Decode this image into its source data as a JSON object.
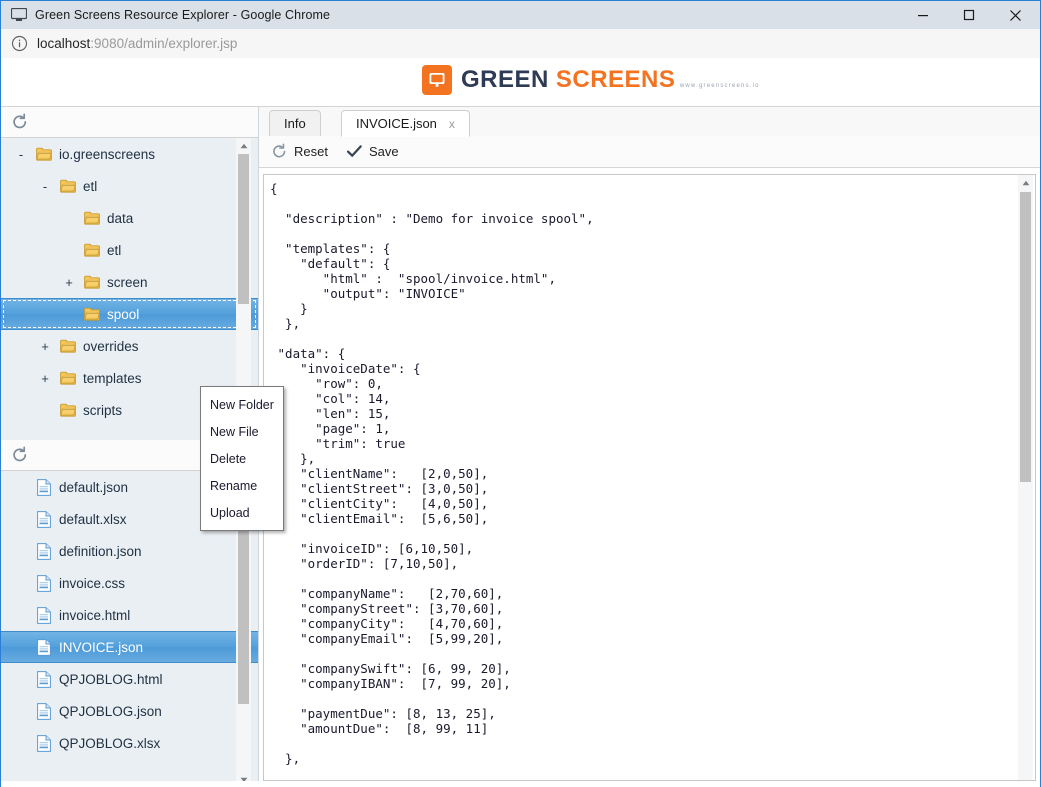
{
  "window": {
    "title": "Green Screens Resource Explorer - Google Chrome",
    "minimize_label": "Minimize",
    "maximize_label": "Maximize",
    "close_label": "Close"
  },
  "address_bar": {
    "host": "localhost",
    "rest": ":9080/admin/explorer.jsp",
    "full_url": "localhost:9080/admin/explorer.jsp",
    "info_icon": "info-circle-icon"
  },
  "brand": {
    "word1": "GREEN",
    "word2": "SCREENS",
    "site": "www.greenscreens.io",
    "mark_icon": "monitor-icon",
    "color_green": "#2e3b55",
    "color_orange": "#f37321"
  },
  "tree_panel": {
    "refresh_icon": "refresh-icon",
    "refresh_label": "Refresh",
    "items": [
      {
        "label": "io.greenscreens",
        "toggle": "-",
        "depth": 0,
        "selected": false,
        "icon": "folder-icon"
      },
      {
        "label": "etl",
        "toggle": "-",
        "depth": 1,
        "selected": false,
        "icon": "folder-icon"
      },
      {
        "label": "data",
        "toggle": "",
        "depth": 2,
        "selected": false,
        "icon": "folder-icon"
      },
      {
        "label": "etl",
        "toggle": "",
        "depth": 2,
        "selected": false,
        "icon": "folder-icon"
      },
      {
        "label": "screen",
        "toggle": "+",
        "depth": 2,
        "selected": false,
        "icon": "folder-icon"
      },
      {
        "label": "spool",
        "toggle": "",
        "depth": 2,
        "selected": true,
        "icon": "folder-icon"
      },
      {
        "label": "overrides",
        "toggle": "+",
        "depth": 1,
        "selected": false,
        "icon": "folder-icon"
      },
      {
        "label": "templates",
        "toggle": "+",
        "depth": 1,
        "selected": false,
        "icon": "folder-icon"
      },
      {
        "label": "scripts",
        "toggle": "",
        "depth": 1,
        "selected": false,
        "icon": "folder-icon"
      }
    ]
  },
  "context_menu": {
    "items": [
      {
        "label": "New Folder"
      },
      {
        "label": "New File"
      },
      {
        "label": "Delete"
      },
      {
        "label": "Rename"
      },
      {
        "label": "Upload"
      }
    ]
  },
  "file_panel": {
    "refresh_icon": "refresh-icon",
    "refresh_label": "Refresh",
    "items": [
      {
        "label": "default.json",
        "selected": false,
        "icon": "file-icon"
      },
      {
        "label": "default.xlsx",
        "selected": false,
        "icon": "file-icon"
      },
      {
        "label": "definition.json",
        "selected": false,
        "icon": "file-icon"
      },
      {
        "label": "invoice.css",
        "selected": false,
        "icon": "file-icon"
      },
      {
        "label": "invoice.html",
        "selected": false,
        "icon": "file-icon"
      },
      {
        "label": "INVOICE.json",
        "selected": true,
        "icon": "file-icon"
      },
      {
        "label": "QPJOBLOG.html",
        "selected": false,
        "icon": "file-icon"
      },
      {
        "label": "QPJOBLOG.json",
        "selected": false,
        "icon": "file-icon"
      },
      {
        "label": "QPJOBLOG.xlsx",
        "selected": false,
        "icon": "file-icon"
      }
    ]
  },
  "tabs": [
    {
      "label": "Info",
      "active": false,
      "closable": false
    },
    {
      "label": "INVOICE.json",
      "active": true,
      "closable": true,
      "close_glyph": "x"
    }
  ],
  "editor_toolbar": {
    "reset_label": "Reset",
    "reset_icon": "refresh-icon",
    "save_label": "Save",
    "save_icon": "check-icon"
  },
  "editor": {
    "filename": "INVOICE.json",
    "content": "{\n\n  \"description\" : \"Demo for invoice spool\",\n\n  \"templates\": {\n    \"default\": {\n       \"html\" :  \"spool/invoice.html\",\n       \"output\": \"INVOICE\"\n    }\n  },\n\n \"data\": {\n    \"invoiceDate\": {\n      \"row\": 0,\n      \"col\": 14,\n      \"len\": 15,\n      \"page\": 1,\n      \"trim\": true\n    },\n    \"clientName\":   [2,0,50],\n    \"clientStreet\": [3,0,50],\n    \"clientCity\":   [4,0,50],\n    \"clientEmail\":  [5,6,50],\n\n    \"invoiceID\": [6,10,50],\n    \"orderID\": [7,10,50],\n\n    \"companyName\":   [2,70,60],\n    \"companyStreet\": [3,70,60],\n    \"companyCity\":   [4,70,60],\n    \"companyEmail\":  [5,99,20],\n\n    \"companySwift\": [6, 99, 20],\n    \"companyIBAN\":  [7, 99, 20],\n\n    \"paymentDue\": [8, 13, 25],\n    \"amountDue\":  [8, 99, 11]\n\n  },"
  }
}
